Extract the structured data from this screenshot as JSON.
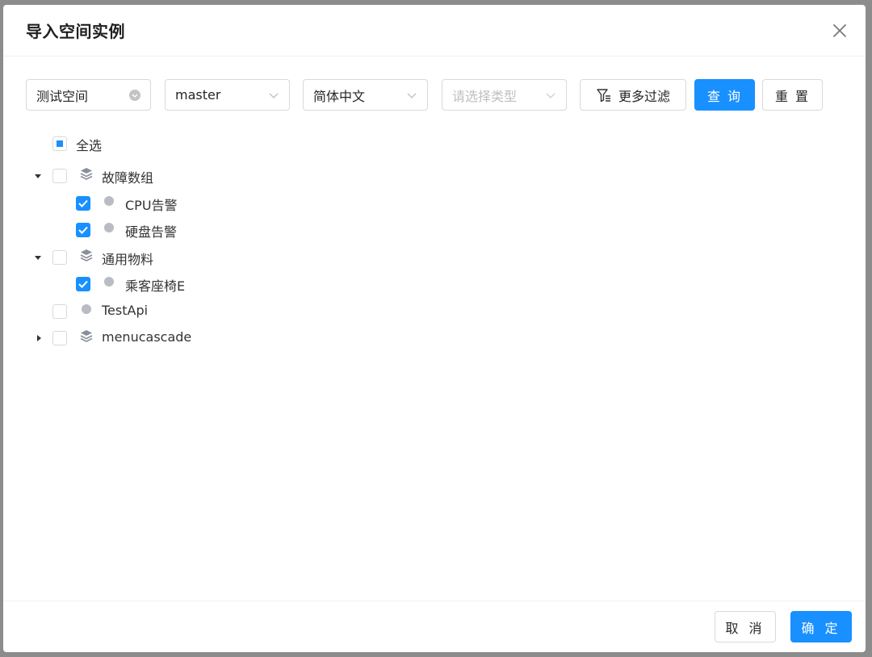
{
  "dialog": {
    "title": "导入空间实例"
  },
  "filters": {
    "space": "测试空间",
    "branch": "master",
    "language": "简体中文",
    "type_placeholder": "请选择类型",
    "more_filters_label": "更多过滤",
    "query_label": "查 询",
    "reset_label": "重 置"
  },
  "tree": {
    "select_all_label": "全选",
    "nodes": [
      {
        "label": "故障数组",
        "kind": "group",
        "expanded": true,
        "checked": false,
        "children": [
          {
            "label": "CPU告警",
            "checked": true
          },
          {
            "label": "硬盘告警",
            "checked": true
          }
        ]
      },
      {
        "label": "通用物料",
        "kind": "group",
        "expanded": true,
        "checked": false,
        "children": [
          {
            "label": "乘客座椅E",
            "checked": true
          }
        ]
      },
      {
        "label": "TestApi",
        "kind": "leaf",
        "checked": false
      },
      {
        "label": "menucascade",
        "kind": "group",
        "expanded": false,
        "checked": false
      }
    ]
  },
  "footer": {
    "cancel_label": "取 消",
    "ok_label": "确 定"
  },
  "colors": {
    "primary": "#1890ff",
    "border": "#d9d9d9",
    "dot": "#b9bcc4"
  }
}
